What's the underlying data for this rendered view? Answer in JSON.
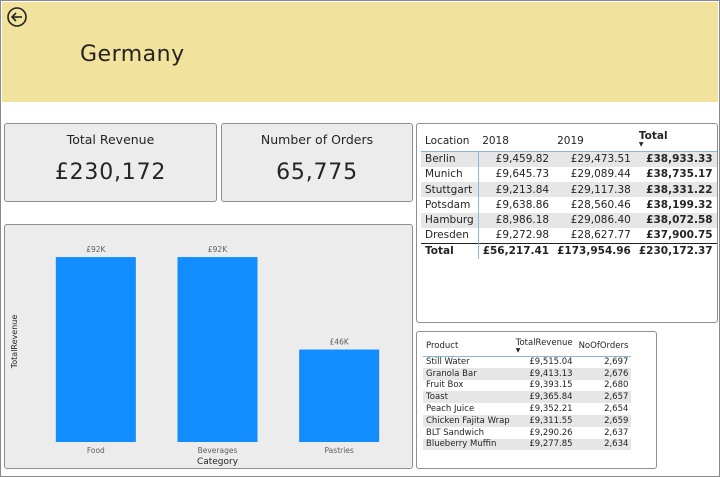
{
  "header": {
    "title": "Germany",
    "back_icon": "back-arrow-icon",
    "background": "#f1e29d"
  },
  "kpis": {
    "revenue": {
      "label": "Total Revenue",
      "value": "£230,172"
    },
    "orders": {
      "label": "Number of Orders",
      "value": "65,775"
    }
  },
  "location_matrix": {
    "headers": [
      "Location",
      "2018",
      "2019",
      "Total"
    ],
    "sorted_column": "Total",
    "rows": [
      [
        "Berlin",
        "£9,459.82",
        "£29,473.51",
        "£38,933.33"
      ],
      [
        "Munich",
        "£9,645.73",
        "£29,089.44",
        "£38,735.17"
      ],
      [
        "Stuttgart",
        "£9,213.84",
        "£29,117.38",
        "£38,331.22"
      ],
      [
        "Potsdam",
        "£9,638.86",
        "£28,560.46",
        "£38,199.32"
      ],
      [
        "Hamburg",
        "£8,986.18",
        "£29,086.40",
        "£38,072.58"
      ],
      [
        "Dresden",
        "£9,272.98",
        "£28,627.77",
        "£37,900.75"
      ]
    ],
    "total_row": [
      "Total",
      "£56,217.41",
      "£173,954.96",
      "£230,172.37"
    ]
  },
  "product_table": {
    "headers": [
      "Product",
      "TotalRevenue",
      "NoOfOrders"
    ],
    "sorted_column": "TotalRevenue",
    "rows": [
      [
        "Still Water",
        "£9,515.04",
        "2,697"
      ],
      [
        "Granola Bar",
        "£9,413.13",
        "2,676"
      ],
      [
        "Fruit Box",
        "£9,393.15",
        "2,680"
      ],
      [
        "Toast",
        "£9,365.84",
        "2,657"
      ],
      [
        "Peach Juice",
        "£9,352.21",
        "2,654"
      ],
      [
        "Chicken Fajita Wrap",
        "£9,311.55",
        "2,659"
      ],
      [
        "BLT Sandwich",
        "£9,290.26",
        "2,637"
      ],
      [
        "Blueberry Muffin",
        "£9,277.85",
        "2,634"
      ]
    ]
  },
  "chart_data": {
    "type": "bar",
    "categories": [
      "Food",
      "Beverages",
      "Pastries"
    ],
    "values": [
      92,
      92,
      46
    ],
    "data_labels": [
      "£92K",
      "£92K",
      "£46K"
    ],
    "xlabel": "Category",
    "ylabel": "TotalRevenue",
    "ylim": [
      0,
      100
    ],
    "bar_color": "#118dff",
    "grid": false
  }
}
